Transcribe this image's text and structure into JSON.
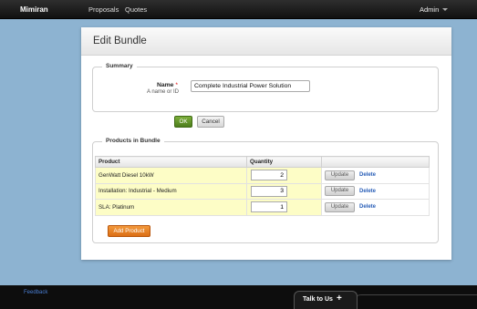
{
  "app": {
    "brand": "Mimiran",
    "nav": [
      "Proposals",
      "Quotes"
    ],
    "user_menu": "Admin"
  },
  "page": {
    "title": "Edit Bundle"
  },
  "summary": {
    "legend": "Summary",
    "name_label": "Name",
    "required_mark": "*",
    "name_hint": "A name or ID",
    "name_value": "Complete Industrial Power Solution"
  },
  "actions": {
    "ok_label": "OK",
    "cancel_label": "Cancel"
  },
  "products": {
    "legend": "Products in Bundle",
    "columns": [
      "Product",
      "Quantity"
    ],
    "rows": [
      {
        "name": "GenWatt Diesel 10kW",
        "quantity": "2"
      },
      {
        "name": "Installation: Industrial - Medium",
        "quantity": "3"
      },
      {
        "name": "SLA: Platinum",
        "quantity": "1"
      }
    ],
    "update_label": "Update",
    "delete_label": "Delete",
    "add_label": "Add Product"
  },
  "footer": {
    "feedback_label": "Feedback",
    "talk_label": "Talk to Us",
    "talk_icon": "+"
  }
}
